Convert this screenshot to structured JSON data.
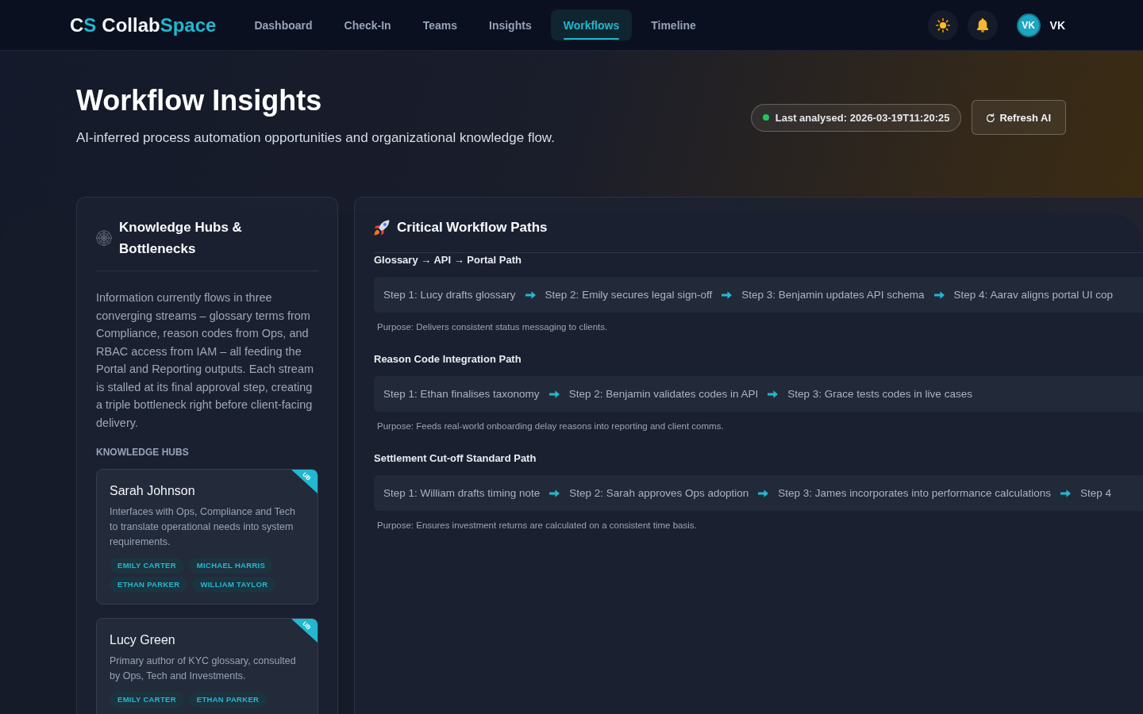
{
  "header": {
    "logo": {
      "mark": [
        {
          "text": "C",
          "accent": false
        },
        {
          "text": "S",
          "accent": true
        }
      ],
      "name": [
        {
          "text": "Collab",
          "accent": false
        },
        {
          "text": "Space",
          "accent": true
        }
      ]
    },
    "nav": [
      {
        "label": "Dashboard",
        "selected": false
      },
      {
        "label": "Check-In",
        "selected": false
      },
      {
        "label": "Teams",
        "selected": false
      },
      {
        "label": "Insights",
        "selected": false
      },
      {
        "label": "Workflows",
        "selected": true
      },
      {
        "label": "Timeline",
        "selected": false
      }
    ],
    "user": {
      "initials": "VK",
      "name": "VK"
    }
  },
  "hero": {
    "title": "Workflow Insights",
    "subtitle": "AI-inferred process automation opportunities and organizational knowledge flow.",
    "status": "Last analysed: 2026-03-19T11:20:25",
    "refresh_button": "Refresh AI"
  },
  "knowledge_panel": {
    "title": "Knowledge Hubs & Bottlenecks",
    "summary": "Information currently flows in three converging streams – glossary terms from Compliance, reason codes from Ops, and RBAC access from IAM – all feeding the Portal and Reporting outputs. Each stream is stalled at its final approval step, creating a triple bottleneck right before client-facing delivery.",
    "hubs_label": "KNOWLEDGE HUBS",
    "hubs": [
      {
        "name": "Sarah Johnson",
        "ribbon": "UB",
        "description": "Interfaces with Ops, Compliance and Tech to translate operational needs into system requirements.",
        "contacts": [
          "EMILY CARTER",
          "MICHAEL HARRIS",
          "ETHAN PARKER",
          "WILLIAM TAYLOR"
        ]
      },
      {
        "name": "Lucy Green",
        "ribbon": "UB",
        "description": "Primary author of KYC glossary, consulted by Ops, Tech and Investments.",
        "contacts": [
          "EMILY CARTER",
          "ETHAN PARKER"
        ]
      }
    ]
  },
  "workflow_panel": {
    "title": "Critical Workflow Paths",
    "paths": [
      {
        "title": "Glossary → API → Portal Path",
        "steps": [
          "Step 1: Lucy drafts glossary",
          "Step 2: Emily secures legal sign-off",
          "Step 3: Benjamin updates API schema",
          "Step 4: Aarav aligns portal UI cop"
        ],
        "purpose": "Purpose: Delivers consistent status messaging to clients."
      },
      {
        "title": "Reason Code Integration Path",
        "steps": [
          "Step 1: Ethan finalises taxonomy",
          "Step 2: Benjamin validates codes in API",
          "Step 3: Grace tests codes in live cases"
        ],
        "purpose": "Purpose: Feeds real-world onboarding delay reasons into reporting and client comms."
      },
      {
        "title": "Settlement Cut-off Standard Path",
        "steps": [
          "Step 1: William drafts timing note",
          "Step 2: Sarah approves Ops adoption",
          "Step 3: James incorporates into performance calculations",
          "Step 4"
        ],
        "purpose": "Purpose: Ensures investment returns are calculated on a consistent time basis."
      }
    ]
  }
}
